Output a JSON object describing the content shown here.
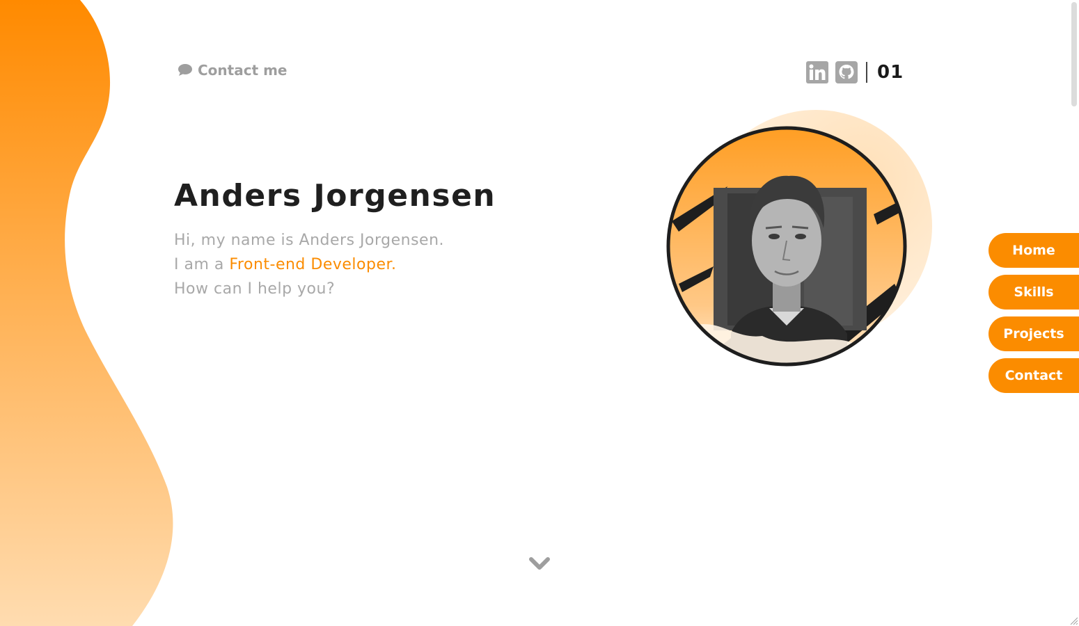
{
  "header": {
    "contact_label": "Contact me",
    "contact_icon": "chat-bubble-icon",
    "social": [
      {
        "name": "linkedin",
        "icon": "linkedin-icon"
      },
      {
        "name": "github",
        "icon": "github-icon"
      }
    ],
    "page_number": "01"
  },
  "hero": {
    "name": "Anders Jorgensen",
    "line1": "Hi, my name is Anders Jorgensen.",
    "line2_prefix": "I am a ",
    "line2_role": "Front-end Developer",
    "line2_suffix": ".",
    "line3": "How can I help you?"
  },
  "nav": {
    "items": [
      {
        "label": "Home"
      },
      {
        "label": "Skills"
      },
      {
        "label": "Projects"
      },
      {
        "label": "Contact"
      }
    ]
  },
  "colors": {
    "accent": "#fb8c00",
    "accent_light": "#ffe0b2",
    "text_dark": "#1f1f1f",
    "text_muted": "#a8a8a8"
  }
}
